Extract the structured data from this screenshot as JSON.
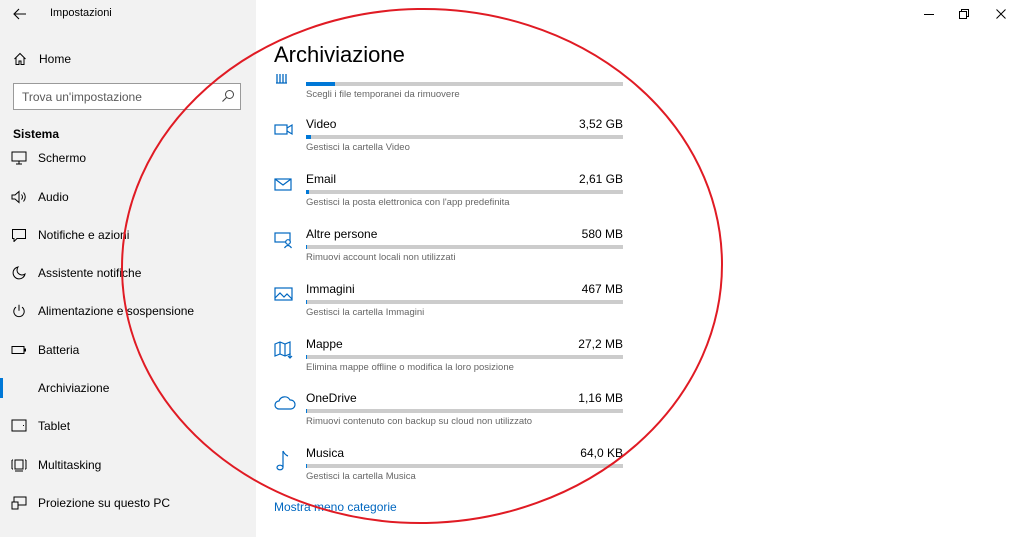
{
  "window": {
    "title": "Impostazioni",
    "controls": [
      "minimize-icon",
      "restore-icon",
      "close-icon"
    ]
  },
  "sidebar": {
    "home_label": "Home",
    "search_placeholder": "Trova un'impostazione",
    "section_title": "Sistema",
    "items": [
      {
        "label": "Schermo",
        "icon": "monitor-icon"
      },
      {
        "label": "Audio",
        "icon": "speaker-icon"
      },
      {
        "label": "Notifiche e azioni",
        "icon": "notification-icon"
      },
      {
        "label": "Assistente notifiche",
        "icon": "moon-icon"
      },
      {
        "label": "Alimentazione e sospensione",
        "icon": "power-icon"
      },
      {
        "label": "Batteria",
        "icon": "battery-icon"
      },
      {
        "label": "Archiviazione",
        "icon": "storage-icon",
        "active": true
      },
      {
        "label": "Tablet",
        "icon": "tablet-icon"
      },
      {
        "label": "Multitasking",
        "icon": "multitasking-icon"
      },
      {
        "label": "Proiezione su questo PC",
        "icon": "projection-icon"
      }
    ]
  },
  "main": {
    "title": "Archiviazione",
    "partial_category": {
      "desc": "Scegli i file temporanei da rimuovere",
      "icon": "trash-icon",
      "usage_fraction": 0.09
    },
    "categories": [
      {
        "name": "Video",
        "size": "3,52 GB",
        "desc": "Gestisci la cartella Video",
        "icon": "video-icon",
        "usage_fraction": 0.015
      },
      {
        "name": "Email",
        "size": "2,61 GB",
        "desc": "Gestisci la posta elettronica con l'app predefinita",
        "icon": "mail-icon",
        "usage_fraction": 0.011
      },
      {
        "name": "Altre persone",
        "size": "580 MB",
        "desc": "Rimuovi account locali non utilizzati",
        "icon": "people-icon",
        "usage_fraction": 0.004
      },
      {
        "name": "Immagini",
        "size": "467 MB",
        "desc": "Gestisci la cartella Immagini",
        "icon": "image-icon",
        "usage_fraction": 0.003
      },
      {
        "name": "Mappe",
        "size": "27,2 MB",
        "desc": "Elimina mappe offline o modifica la loro posizione",
        "icon": "map-icon",
        "usage_fraction": 0.001
      },
      {
        "name": "OneDrive",
        "size": "1,16 MB",
        "desc": "Rimuovi contenuto con backup su cloud non utilizzato",
        "icon": "cloud-icon",
        "usage_fraction": 0.001
      },
      {
        "name": "Musica",
        "size": "64,0 KB",
        "desc": "Gestisci la cartella Musica",
        "icon": "music-icon",
        "usage_fraction": 0.001
      }
    ],
    "show_less_link": "Mostra meno categorie"
  },
  "colors": {
    "accent": "#0078d7",
    "link": "#0067c0",
    "annotation": "#e01b24",
    "sidebar_bg": "#f2f2f2"
  }
}
